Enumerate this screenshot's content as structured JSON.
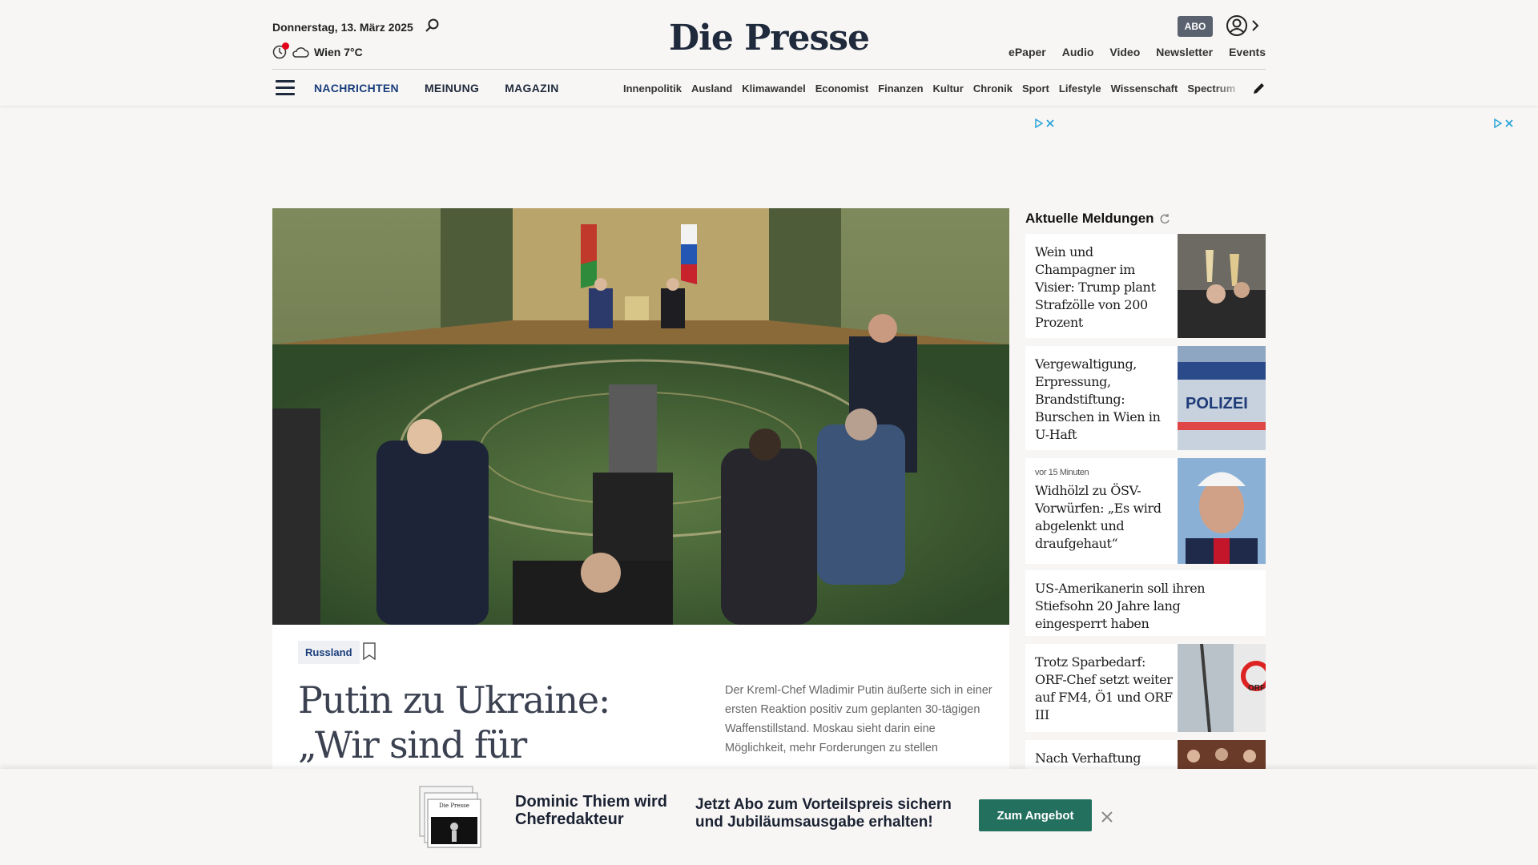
{
  "header": {
    "date": "Donnerstag, 13. März 2025",
    "weather": "Wien 7°C",
    "logo": "Die Presse",
    "abo_label": "ABO",
    "top_links": [
      "ePaper",
      "Audio",
      "Video",
      "Newsletter",
      "Events"
    ],
    "main_nav": [
      "NACHRICHTEN",
      "MEINUNG",
      "MAGAZIN"
    ],
    "sub_nav": [
      "Innenpolitik",
      "Ausland",
      "Klimawandel",
      "Economist",
      "Finanzen",
      "Kultur",
      "Chronik",
      "Sport",
      "Lifestyle",
      "Wissenschaft",
      "Spectrum"
    ]
  },
  "hero": {
    "tag": "Russland",
    "headline": "Putin zu Ukraine: „Wir sind für",
    "lead": "Der Kreml-Chef Wladimir Putin äußerte sich in einer ersten Reaktion positiv zum geplanten 30-tägigen Waffenstillstand. Moskau sieht darin eine Möglichkeit, mehr Forderungen zu stellen"
  },
  "sidebar": {
    "title": "Aktuelle Meldungen",
    "items": [
      {
        "time": "",
        "text": "Wein und Champagner im Visier: Trump plant Strafzölle von 200 Prozent"
      },
      {
        "time": "",
        "text": "Vergewaltigung, Erpressung, Brandstiftung: Burschen in Wien in U-Haft"
      },
      {
        "time": "vor 15 Minuten",
        "text": "Widhölzl zu ÖSV-Vorwürfen: „Es wird abgelenkt und draufgehaut“"
      },
      {
        "time": "",
        "text": "US-Amerikanerin soll ihren Stiefsohn 20 Jahre lang eingesperrt haben"
      },
      {
        "time": "",
        "text": "Trotz Sparbedarf: ORF-Chef setzt weiter auf FM4, Ö1 und ORF III"
      },
      {
        "time": "",
        "text": "Nach Verhaftung"
      }
    ],
    "thumb_texts": {
      "polizei": "POLIZEI",
      "orf": "ORF"
    }
  },
  "promo": {
    "title": "Dominic Thiem wird Chefredakteur",
    "text": "Jetzt Abo zum Vorteilspreis sichern und Jubiläumsausgabe erhalten!",
    "button": "Zum Angebot",
    "newspaper_logo": "Die Presse"
  },
  "colors": {
    "brand": "#1f2a3c",
    "accent_blue": "#1a3d7c",
    "cta_green": "#23705f",
    "breaking_red": "#e3001b"
  }
}
